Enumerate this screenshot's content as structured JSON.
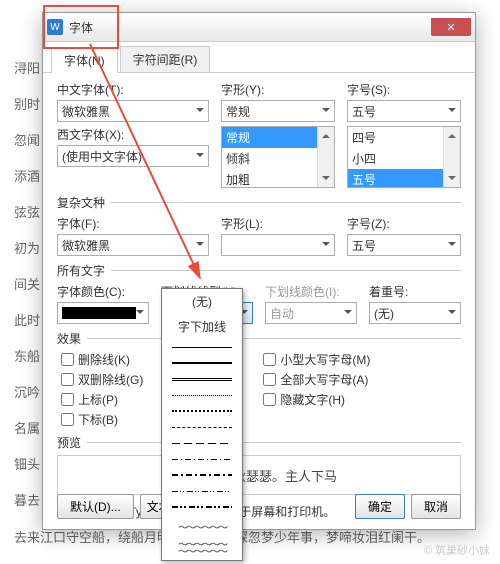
{
  "dialog": {
    "title": "字体",
    "app_icon": "W",
    "tabs": {
      "font": "字体(N)",
      "spacing": "字符间距(R)"
    },
    "labels": {
      "cn_font": "中文字体(T):",
      "style": "字形(Y):",
      "size": "字号(S):",
      "west_font": "西文字体(X):",
      "complex": "复杂文种",
      "font_f": "字体(F):",
      "style_l": "字形(L):",
      "size_z": "字号(Z):",
      "all_text": "所有文字",
      "font_color": "字体颜色(C):",
      "underline_style": "下划线线型(U):",
      "underline_color": "下划线颜色(I):",
      "emphasis": "着重号:",
      "effects": "效果",
      "preview": "预览",
      "truetype_note": "这是一种TrueType字体，同时适用于屏幕和打印机。"
    },
    "values": {
      "cn_font": "微软雅黑",
      "style": "常规",
      "size": "五号",
      "west_font": "(使用中文字体)",
      "font_f": "微软雅黑",
      "style_l": "",
      "size_z": "五号",
      "underline_style": "(无)",
      "underline_color": "自动",
      "emphasis": "(无)",
      "preview_text": "枫叶荻花秋瑟瑟。主人下马"
    },
    "style_list": [
      "常规",
      "倾斜",
      "加粗"
    ],
    "size_list": [
      "四号",
      "小四",
      "五号"
    ],
    "effects_left": [
      {
        "k": "strike",
        "label": "删除线(K)"
      },
      {
        "k": "dstrike",
        "label": "双删除线(G)"
      },
      {
        "k": "super",
        "label": "上标(P)"
      },
      {
        "k": "sub",
        "label": "下标(B)"
      }
    ],
    "effects_right": [
      {
        "k": "smallcaps",
        "label": "小型大写字母(M)"
      },
      {
        "k": "allcaps",
        "label": "全部大写字母(A)"
      },
      {
        "k": "hidden",
        "label": "隐藏文字(H)"
      }
    ],
    "buttons": {
      "default": "默认(D)...",
      "textfx": "文本效果",
      "ok": "确定",
      "cancel": "取消"
    },
    "dropdown": {
      "none": "(无)",
      "words": "字下加线"
    }
  },
  "bg_lines": [
    "浔阳",
    "别时",
    "忽闻",
    "添酒",
    "弦弦",
    "初为",
    "间关",
    "此时",
    "东船",
    "沉吟",
    "名属",
    "钿头",
    "暮去",
    "去来江口守空船，绕船月明江水寒。夜深忽梦少年事，梦啼妆泪红阑干。"
  ],
  "watermark": "© 筑巢砂小妹"
}
